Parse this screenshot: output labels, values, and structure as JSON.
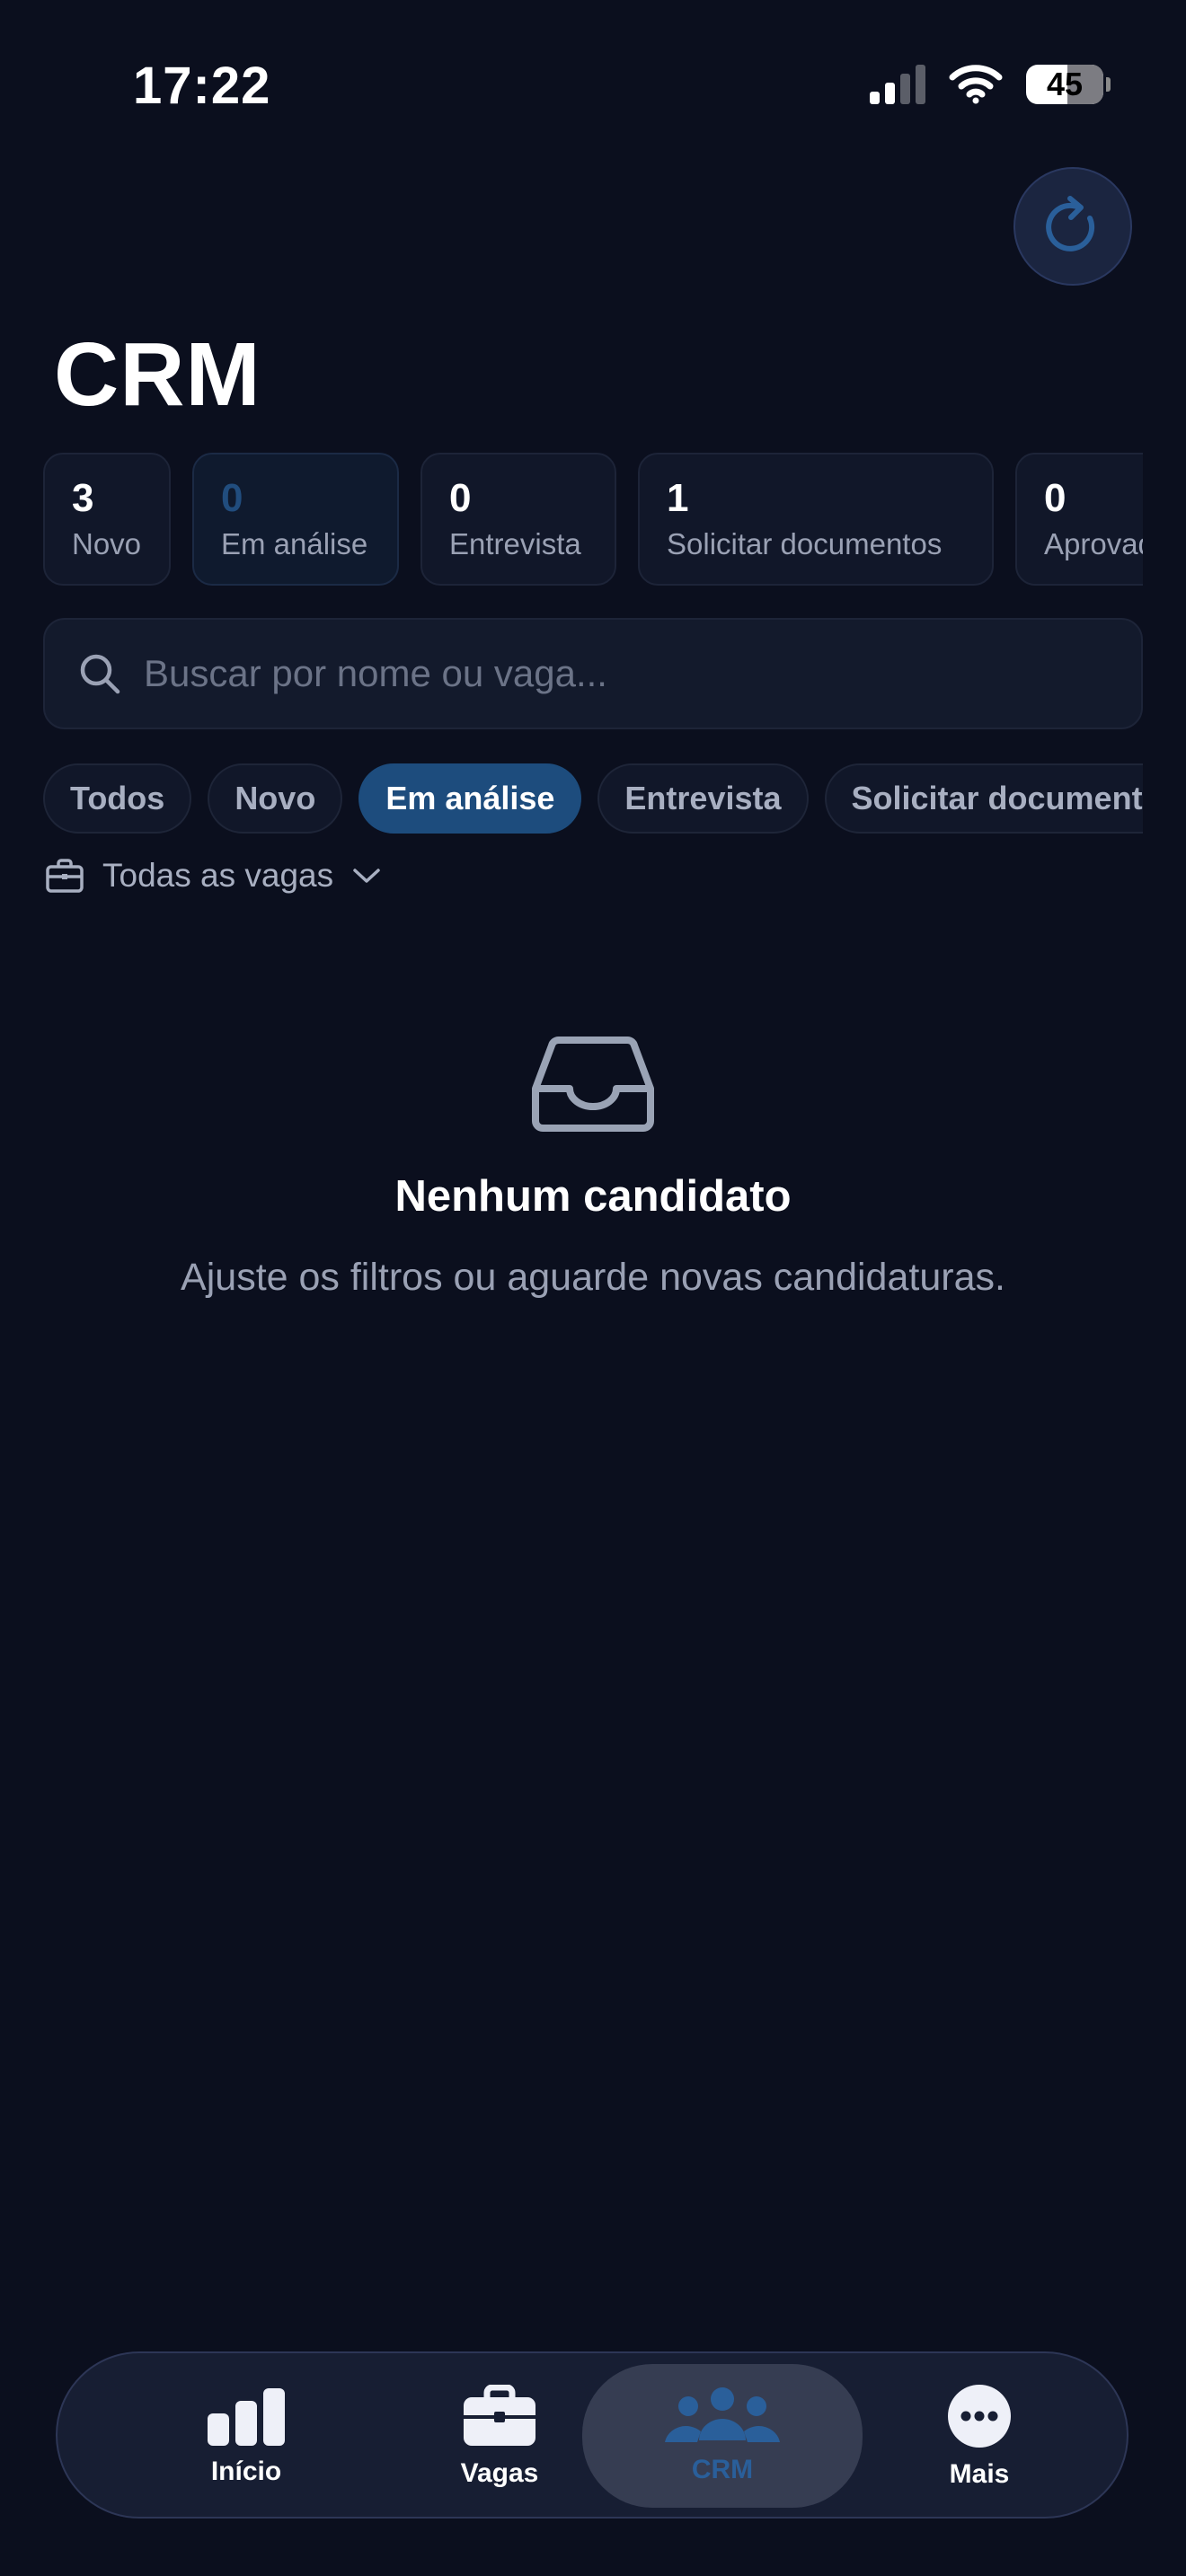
{
  "status_bar": {
    "time": "17:22",
    "battery": "45"
  },
  "header": {
    "title": "CRM"
  },
  "stats": [
    {
      "count": "3",
      "label": "Novo",
      "active": false
    },
    {
      "count": "0",
      "label": "Em análise",
      "active": true
    },
    {
      "count": "0",
      "label": "Entrevista",
      "active": false
    },
    {
      "count": "1",
      "label": "Solicitar documentos",
      "active": false
    },
    {
      "count": "0",
      "label": "Aprovado",
      "active": false
    }
  ],
  "search": {
    "placeholder": "Buscar por nome ou vaga..."
  },
  "filters": [
    "Todos",
    "Novo",
    "Em análise",
    "Entrevista",
    "Solicitar documentos"
  ],
  "active_filter": "Em análise",
  "vagas_filter": {
    "label": "Todas as vagas"
  },
  "empty_state": {
    "title": "Nenhum candidato",
    "subtitle": "Ajuste os filtros ou aguarde novas candidaturas."
  },
  "tabbar": {
    "items": [
      {
        "label": "Início",
        "icon": "chart-bars-icon"
      },
      {
        "label": "Vagas",
        "icon": "briefcase-icon"
      },
      {
        "label": "CRM",
        "icon": "people-icon"
      },
      {
        "label": "Mais",
        "icon": "more-icon"
      }
    ],
    "active": "CRM"
  },
  "colors": {
    "background": "#0b0f1e",
    "accent": "#1d4c7d",
    "active_tab_text": "#2a5f9a"
  }
}
